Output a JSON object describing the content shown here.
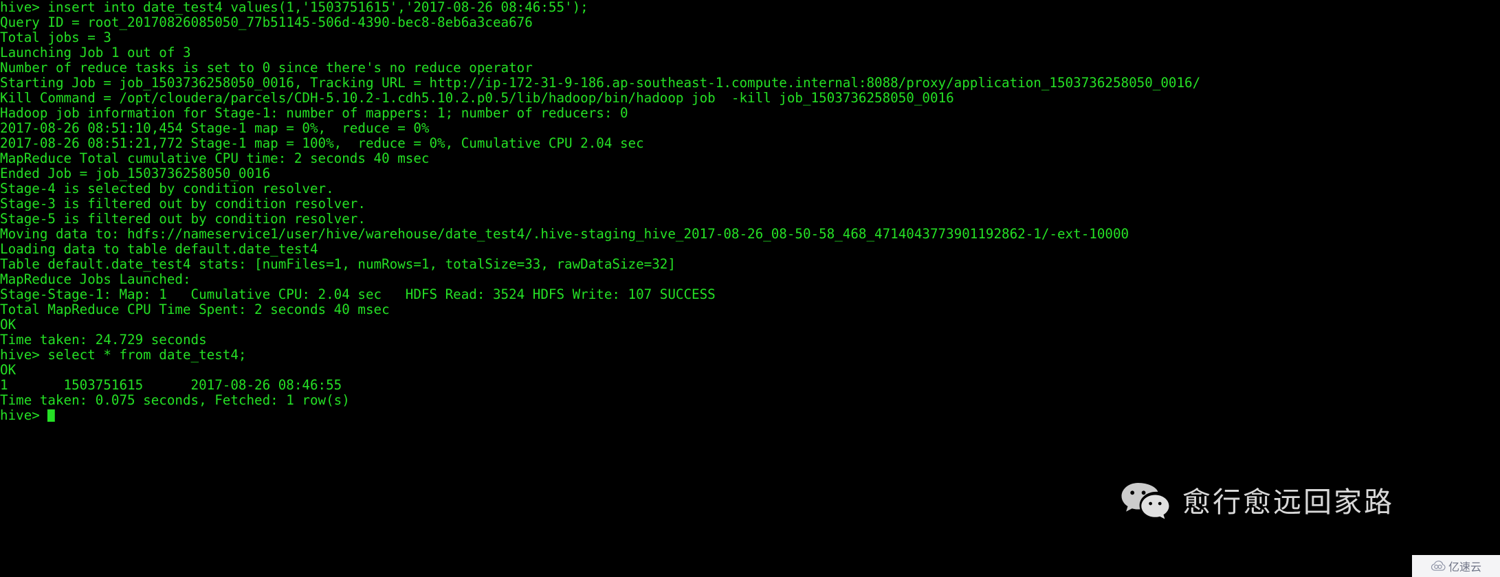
{
  "terminal": {
    "background_color": "#000000",
    "text_color": "#25e025",
    "prompt": "hive>",
    "cursor": "block",
    "lines": [
      "hive> insert into date_test4 values(1,'1503751615','2017-08-26 08:46:55');",
      "Query ID = root_20170826085050_77b51145-506d-4390-bec8-8eb6a3cea676",
      "Total jobs = 3",
      "Launching Job 1 out of 3",
      "Number of reduce tasks is set to 0 since there's no reduce operator",
      "Starting Job = job_1503736258050_0016, Tracking URL = http://ip-172-31-9-186.ap-southeast-1.compute.internal:8088/proxy/application_1503736258050_0016/",
      "Kill Command = /opt/cloudera/parcels/CDH-5.10.2-1.cdh5.10.2.p0.5/lib/hadoop/bin/hadoop job  -kill job_1503736258050_0016",
      "Hadoop job information for Stage-1: number of mappers: 1; number of reducers: 0",
      "2017-08-26 08:51:10,454 Stage-1 map = 0%,  reduce = 0%",
      "2017-08-26 08:51:21,772 Stage-1 map = 100%,  reduce = 0%, Cumulative CPU 2.04 sec",
      "MapReduce Total cumulative CPU time: 2 seconds 40 msec",
      "Ended Job = job_1503736258050_0016",
      "Stage-4 is selected by condition resolver.",
      "Stage-3 is filtered out by condition resolver.",
      "Stage-5 is filtered out by condition resolver.",
      "Moving data to: hdfs://nameservice1/user/hive/warehouse/date_test4/.hive-staging_hive_2017-08-26_08-50-58_468_4714043773901192862-1/-ext-10000",
      "Loading data to table default.date_test4",
      "Table default.date_test4 stats: [numFiles=1, numRows=1, totalSize=33, rawDataSize=32]",
      "MapReduce Jobs Launched:",
      "Stage-Stage-1: Map: 1   Cumulative CPU: 2.04 sec   HDFS Read: 3524 HDFS Write: 107 SUCCESS",
      "Total MapReduce CPU Time Spent: 2 seconds 40 msec",
      "OK",
      "Time taken: 24.729 seconds",
      "hive> select * from date_test4;",
      "OK",
      "1\t1503751615\t2017-08-26 08:46:55",
      "Time taken: 0.075 seconds, Fetched: 1 row(s)"
    ],
    "prompt_line": "hive>"
  },
  "watermarks": {
    "wechat": {
      "icon": "wechat-icon",
      "title": "愈行愈远回家路",
      "color": "#e9e9e9"
    },
    "site_badge": {
      "icon": "cloud-icon",
      "text": "亿速云",
      "background_color": "#f4f4f6",
      "text_color": "#6f7486"
    }
  }
}
